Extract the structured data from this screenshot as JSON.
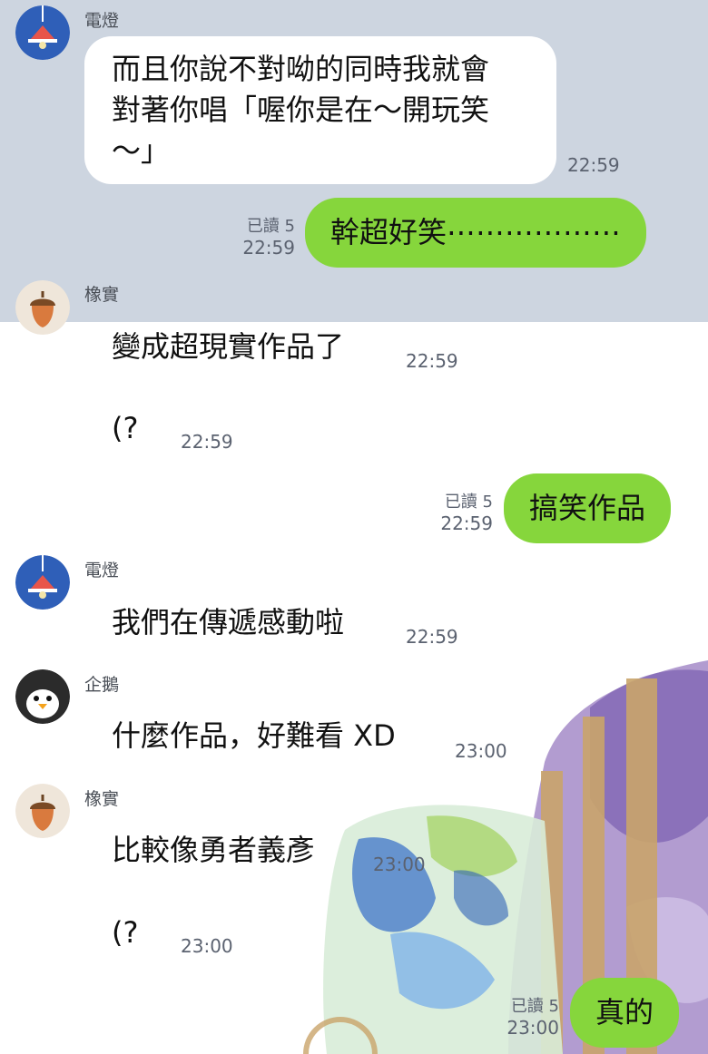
{
  "colors": {
    "top_bg": "#cdd5e0",
    "own_bubble": "#86d63c",
    "other_bubble": "#ffffff",
    "meta_text": "#5b6270"
  },
  "messages": [
    {
      "sender": "電燈",
      "avatar": "lamp-icon",
      "lines": [
        "而且你說不對呦的同時我就會",
        "對著你唱「喔你是在～開玩笑",
        "～」"
      ],
      "time": "22:59"
    },
    {
      "own": true,
      "read": "已讀 5",
      "text": "幹超好笑⋯⋯⋯⋯⋯⋯",
      "time": "22:59"
    },
    {
      "sender": "橡實",
      "avatar": "acorn-icon",
      "text": "變成超現實作品了",
      "time": "22:59"
    },
    {
      "text": "(?",
      "time": "22:59"
    },
    {
      "own": true,
      "read": "已讀 5",
      "text": "搞笑作品",
      "time": "22:59"
    },
    {
      "sender": "電燈",
      "avatar": "lamp-icon",
      "text": "我們在傳遞感動啦",
      "time": "22:59"
    },
    {
      "sender": "企鵝",
      "avatar": "penguin-icon",
      "text": "什麼作品，好難看 XD",
      "time": "23:00"
    },
    {
      "sender": "橡實",
      "avatar": "acorn-icon",
      "text": "比較像勇者義彥",
      "time": "23:00"
    },
    {
      "text": "(?",
      "time": "23:00"
    },
    {
      "own": true,
      "read": "已讀 5",
      "text": "真的",
      "time": "23:00"
    }
  ]
}
